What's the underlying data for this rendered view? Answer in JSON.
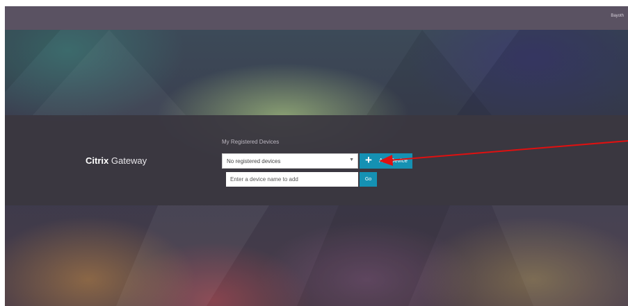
{
  "header": {
    "user_name": "Bayoth"
  },
  "brand": {
    "name_bold": "Citrix",
    "name_regular": "Gateway"
  },
  "devices": {
    "section_title": "My Registered Devices",
    "select_value": "No registered devices",
    "add_label": "Add Device",
    "input_placeholder": "Enter a device name to add",
    "go_label": "Go"
  },
  "colors": {
    "accent": "#1591b3",
    "band": "#3a3740",
    "topbar": "#5a5262",
    "annotation_arrow": "#e01010"
  },
  "icons": {
    "add": "plus-icon",
    "dropdown": "caret-down-icon"
  }
}
